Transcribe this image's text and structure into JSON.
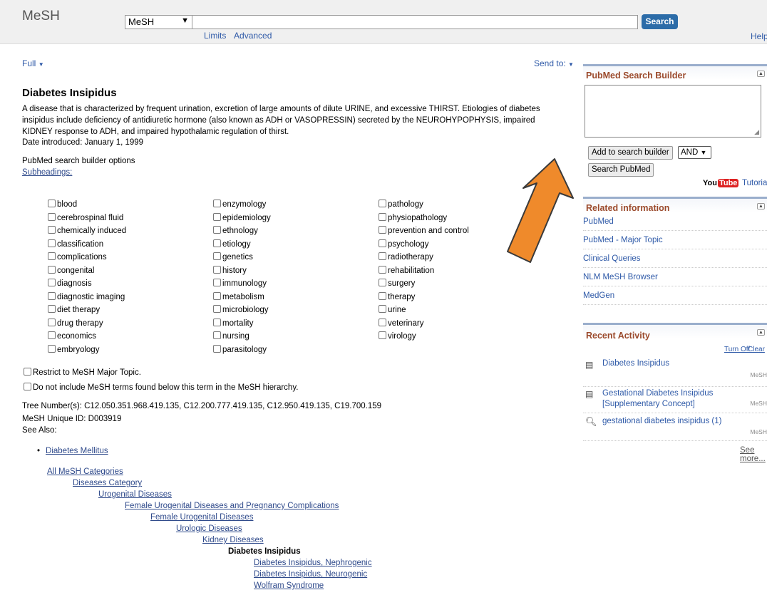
{
  "header": {
    "logo": "MeSH",
    "database_select": "MeSH",
    "search_query": "",
    "search_button": "Search",
    "limits_link": "Limits",
    "advanced_link": "Advanced",
    "help_link": "Help"
  },
  "toolbar": {
    "format_link": "Full",
    "send_to_link": "Send to:"
  },
  "record": {
    "title": "Diabetes Insipidus",
    "description": "A disease that is characterized by frequent urination, excretion of large amounts of dilute URINE, and excessive THIRST. Etiologies of diabetes insipidus include deficiency of antidiuretic hormone (also known as ADH or VASOPRESSIN) secreted by the NEUROHYPOPHYSIS, impaired KIDNEY response to ADH, and impaired hypothalamic regulation of thirst.",
    "date_introduced": "Date introduced: January 1, 1999",
    "builder_options_label": "PubMed search builder options",
    "subheadings_link": "Subheadings:",
    "subheadings": [
      [
        "blood",
        "cerebrospinal fluid",
        "chemically induced",
        "classification",
        "complications",
        "congenital",
        "diagnosis",
        "diagnostic imaging",
        "diet therapy",
        "drug therapy",
        "economics",
        "embryology"
      ],
      [
        "enzymology",
        "epidemiology",
        "ethnology",
        "etiology",
        "genetics",
        "history",
        "immunology",
        "metabolism",
        "microbiology",
        "mortality",
        "nursing",
        "parasitology"
      ],
      [
        "pathology",
        "physiopathology",
        "prevention and control",
        "psychology",
        "radiotherapy",
        "rehabilitation",
        "surgery",
        "therapy",
        "urine",
        "veterinary",
        "virology"
      ]
    ],
    "restrict_major_topic": "Restrict to MeSH Major Topic.",
    "no_include_below": "Do not include MeSH terms found below this term in the MeSH hierarchy.",
    "tree_numbers": "Tree Number(s): C12.050.351.968.419.135, C12.200.777.419.135, C12.950.419.135, C19.700.159",
    "unique_id": "MeSH Unique ID: D003919",
    "see_also_label": "See Also:",
    "see_also_items": [
      "Diabetes Mellitus"
    ],
    "tree": [
      "All MeSH Categories",
      "Diseases Category",
      "Urogenital Diseases",
      "Female Urogenital Diseases and Pregnancy Complications",
      "Female Urogenital Diseases",
      "Urologic Diseases",
      "Kidney Diseases",
      "Diabetes Insipidus",
      "Diabetes Insipidus, Nephrogenic",
      "Diabetes Insipidus, Neurogenic",
      "Wolfram Syndrome"
    ]
  },
  "sidebar": {
    "builder": {
      "title": "PubMed Search Builder",
      "text": "",
      "add_button": "Add to search builder",
      "operator": "AND",
      "search_button": "Search PubMed",
      "youtube_logo": "YouTube",
      "tutorial_link": "Tutorial"
    },
    "related": {
      "title": "Related information",
      "items": [
        "PubMed",
        "PubMed - Major Topic",
        "Clinical Queries",
        "NLM MeSH Browser",
        "MedGen"
      ]
    },
    "recent": {
      "title": "Recent Activity",
      "turn_off": "Turn Off",
      "clear": "Clear",
      "items": [
        {
          "icon": "document-icon",
          "text": "Diabetes Insipidus",
          "db": "MeSH"
        },
        {
          "icon": "document-icon",
          "text": "Gestational Diabetes Insipidus [Supplementary Concept]",
          "db": "MeSH"
        },
        {
          "icon": "search-icon",
          "text": "gestational diabetes insipidus (1)",
          "db": "MeSH"
        }
      ],
      "see_more": "See more..."
    }
  },
  "colors": {
    "accent": "#2c6ca8",
    "sidebar_title": "#9b4a2c",
    "arrow": "#ef8a2b",
    "link": "#2f5aa8"
  }
}
